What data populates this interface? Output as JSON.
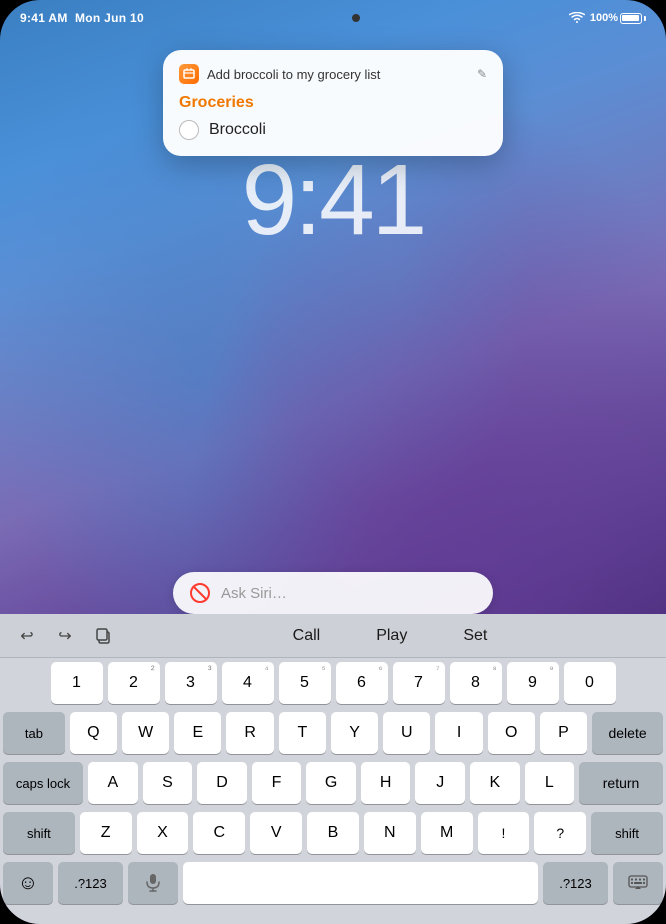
{
  "device": {
    "frame_label": "ipad-frame"
  },
  "status_bar": {
    "time": "9:41 AM",
    "date": "Mon Jun 10",
    "wifi_label": "wifi-icon",
    "battery_percent": "100%"
  },
  "clock": {
    "time": "9:41"
  },
  "notification": {
    "title": "Add broccoli to my grocery list",
    "edit_icon": "✎",
    "list_name": "Groceries",
    "item_name": "Broccoli"
  },
  "siri": {
    "placeholder": "Ask Siri…"
  },
  "keyboard": {
    "toolbar": {
      "undo_label": "↩",
      "redo_label": "↪",
      "copy_label": "⧉",
      "word1": "Call",
      "word2": "Play",
      "word3": "Set"
    },
    "rows": [
      [
        "Q",
        "W",
        "E",
        "R",
        "T",
        "Y",
        "U",
        "I",
        "O",
        "P"
      ],
      [
        "A",
        "S",
        "D",
        "F",
        "G",
        "H",
        "J",
        "K",
        "L"
      ],
      [
        "Z",
        "X",
        "C",
        "V",
        "B",
        "N",
        "M"
      ]
    ],
    "number_chars": [
      "1",
      "2",
      "3",
      "4",
      "5",
      "6",
      "7",
      "8",
      "9",
      "0"
    ],
    "number_sups": [
      "",
      "²",
      "³",
      "⁴",
      "⁵",
      "⁶",
      "⁷",
      "⁸",
      "⁹",
      ""
    ],
    "modifier_keys": {
      "tab": "tab",
      "delete": "delete",
      "caps_lock": "caps lock",
      "return": "return",
      "shift": "shift",
      "emoji": "☺",
      "numbers": ".?123",
      "mic": "🎤",
      "keyboard": "⌨",
      "space": " "
    }
  }
}
